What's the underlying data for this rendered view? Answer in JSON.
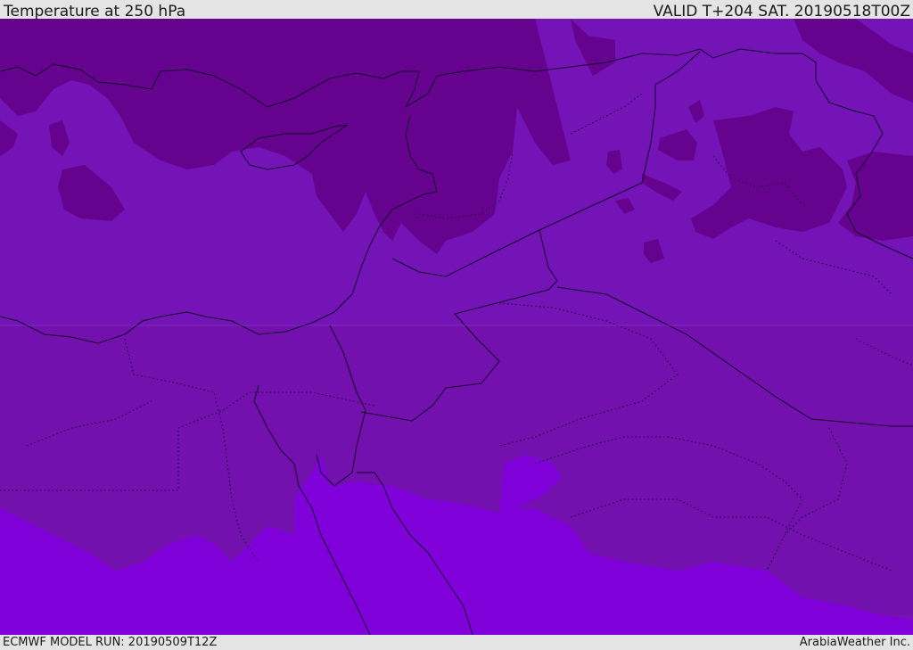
{
  "header": {
    "title": "Temperature at 250 hPa",
    "valid": "VALID T+204 SAT. 20190518T00Z"
  },
  "footer": {
    "model_run": "ECMWF MODEL RUN: 20190509T12Z",
    "brand": "ArabiaWeather Inc."
  },
  "colors": {
    "coldest": "#660099",
    "cold": "#7210b0",
    "mild": "#7a0ed6",
    "warm": "#8000dd",
    "lines": "#1a0530"
  }
}
